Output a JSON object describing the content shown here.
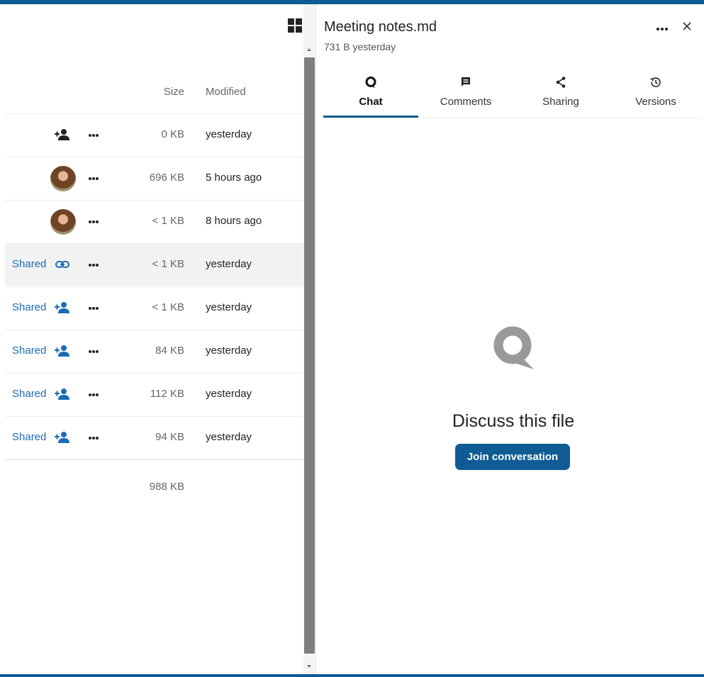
{
  "file_list": {
    "columns": {
      "size": "Size",
      "modified": "Modified"
    },
    "rows": [
      {
        "share_label": "",
        "share_icon": "add-user-icon",
        "avatar": false,
        "size": "0 KB",
        "modified": "yesterday",
        "highlighted": false
      },
      {
        "share_label": "",
        "share_icon": "",
        "avatar": true,
        "size": "696 KB",
        "modified": "5 hours ago",
        "highlighted": false
      },
      {
        "share_label": "",
        "share_icon": "",
        "avatar": true,
        "size": "< 1 KB",
        "modified": "8 hours ago",
        "highlighted": false
      },
      {
        "share_label": "Shared",
        "share_icon": "link-icon",
        "avatar": false,
        "size": "< 1 KB",
        "modified": "yesterday",
        "highlighted": true
      },
      {
        "share_label": "Shared",
        "share_icon": "add-user-icon",
        "avatar": false,
        "size": "< 1 KB",
        "modified": "yesterday",
        "highlighted": false
      },
      {
        "share_label": "Shared",
        "share_icon": "add-user-icon",
        "avatar": false,
        "size": "84 KB",
        "modified": "yesterday",
        "highlighted": false
      },
      {
        "share_label": "Shared",
        "share_icon": "add-user-icon",
        "avatar": false,
        "size": "112 KB",
        "modified": "yesterday",
        "highlighted": false
      },
      {
        "share_label": "Shared",
        "share_icon": "add-user-icon",
        "avatar": false,
        "size": "94 KB",
        "modified": "yesterday",
        "highlighted": false
      }
    ],
    "total_size": "988 KB"
  },
  "sidebar": {
    "title": "Meeting notes.md",
    "subtitle": "731 B yesterday",
    "tabs": [
      {
        "label": "Chat",
        "icon": "chat-icon",
        "active": true
      },
      {
        "label": "Comments",
        "icon": "comment-icon",
        "active": false
      },
      {
        "label": "Sharing",
        "icon": "share-icon",
        "active": false
      },
      {
        "label": "Versions",
        "icon": "history-icon",
        "active": false
      }
    ],
    "empty_state": {
      "icon": "talk-icon",
      "title": "Discuss this file",
      "button": "Join conversation"
    }
  },
  "colors": {
    "accent": "#0f5c94",
    "link": "#1a6db5",
    "highlight_row": "#f2f2f2",
    "scrollbar_thumb": "#7f7f7f"
  }
}
